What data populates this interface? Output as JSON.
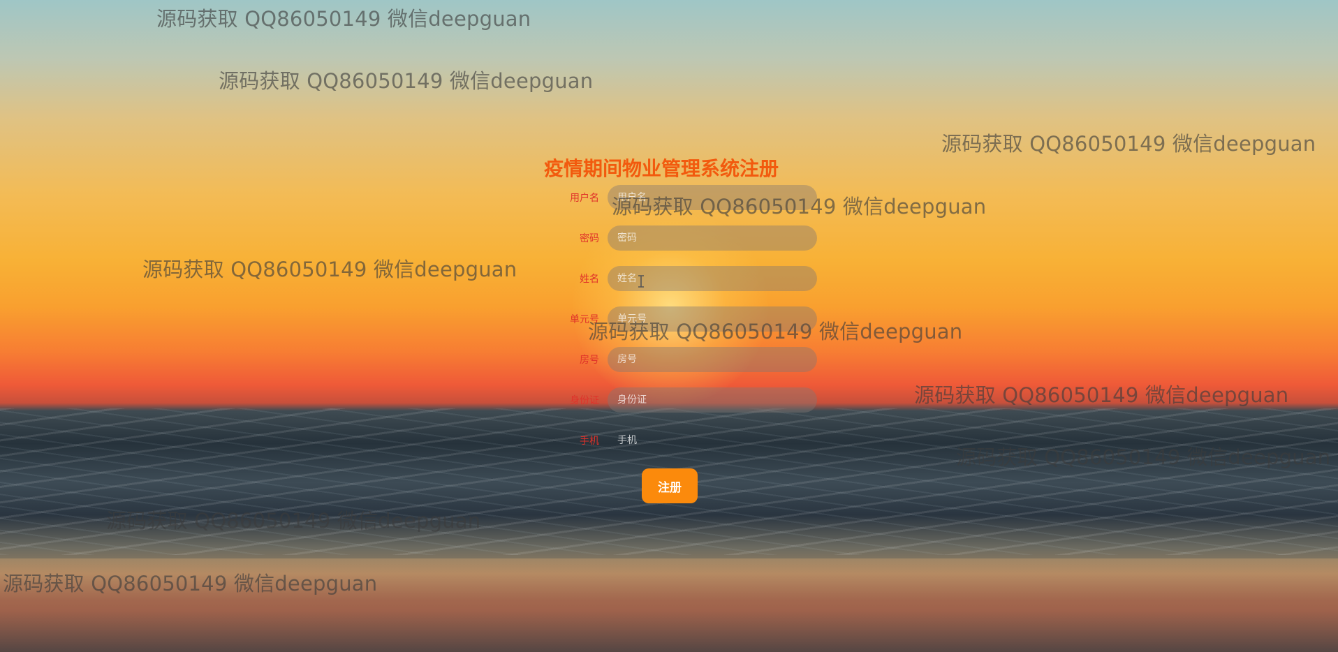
{
  "form": {
    "title": "疫情期间物业管理系统注册",
    "fields": [
      {
        "label": "用户名",
        "placeholder": "用户名",
        "value": ""
      },
      {
        "label": "密码",
        "placeholder": "密码",
        "value": ""
      },
      {
        "label": "姓名",
        "placeholder": "姓名",
        "value": ""
      },
      {
        "label": "单元号",
        "placeholder": "单元号",
        "value": ""
      },
      {
        "label": "房号",
        "placeholder": "房号",
        "value": ""
      },
      {
        "label": "身份证",
        "placeholder": "身份证",
        "value": ""
      },
      {
        "label": "手机",
        "placeholder": "手机",
        "value": ""
      }
    ],
    "submit_label": "注册"
  },
  "watermark": {
    "text": "源码获取 QQ86050149 微信deepguan"
  },
  "colors": {
    "title": "#f25a0e",
    "label": "#e0322a",
    "submit_button": "#fb8a0c"
  },
  "icons": {
    "text_cursor": "text-cursor-icon"
  }
}
